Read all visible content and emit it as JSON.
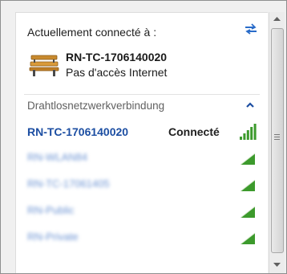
{
  "header": {
    "connected_label": "Actuellement connecté à :",
    "refresh_icon": "refresh-arrows-icon"
  },
  "current_network": {
    "icon": "bench-icon",
    "name": "RN-TC-1706140020",
    "status": "Pas d'accès Internet"
  },
  "section": {
    "label": "Drahtlosnetzwerkverbindung",
    "collapse_icon": "chevron-up-icon"
  },
  "networks": [
    {
      "ssid": "RN-TC-1706140020",
      "status": "Connecté",
      "blurred": false,
      "signal_bars": 5
    },
    {
      "ssid": "RN-WLAN84",
      "status": "",
      "blurred": true,
      "signal_bars": 4
    },
    {
      "ssid": "RN-TC-17061405",
      "status": "",
      "blurred": true,
      "signal_bars": 4
    },
    {
      "ssid": "RN-Public",
      "status": "",
      "blurred": true,
      "signal_bars": 4
    },
    {
      "ssid": "RN-Private",
      "status": "",
      "blurred": true,
      "signal_bars": 4
    }
  ],
  "colors": {
    "active_ssid": "#1c4ea2",
    "blurred_ssid": "#6a92d2",
    "signal_green": "#3c9a2c",
    "signal_gray": "#c8c8c8",
    "chevron": "#1c4ea2"
  }
}
